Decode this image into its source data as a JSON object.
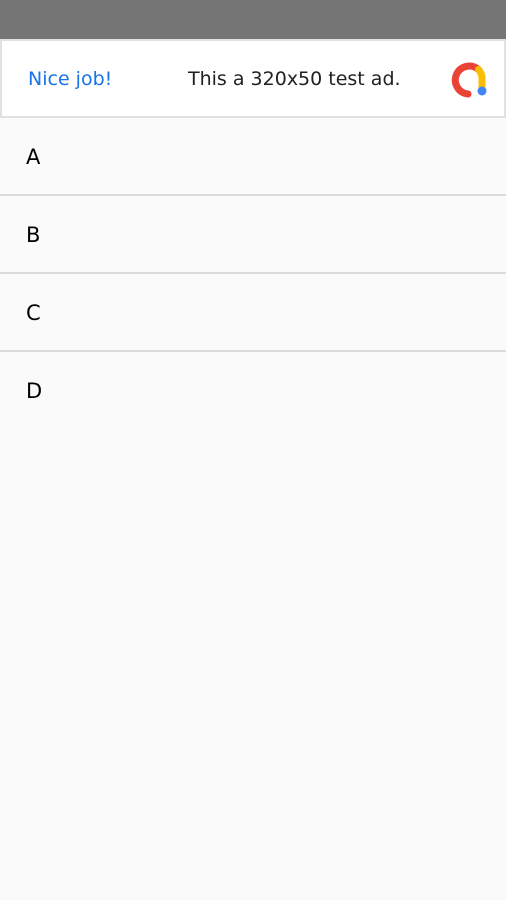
{
  "ad": {
    "headline": "Nice job!",
    "body": "This a 320x50 test ad.",
    "logo_icon": "admob-logo-icon",
    "colors": {
      "headline": "#1a73e8",
      "logo_red": "#ea4335",
      "logo_yellow": "#fbbc04",
      "logo_blue": "#4285f4"
    }
  },
  "list": {
    "items": [
      {
        "label": "A"
      },
      {
        "label": "B"
      },
      {
        "label": "C"
      },
      {
        "label": "D"
      }
    ]
  },
  "colors": {
    "status_bar": "#757575",
    "background": "#fafafa",
    "divider": "#dcdcdc"
  }
}
